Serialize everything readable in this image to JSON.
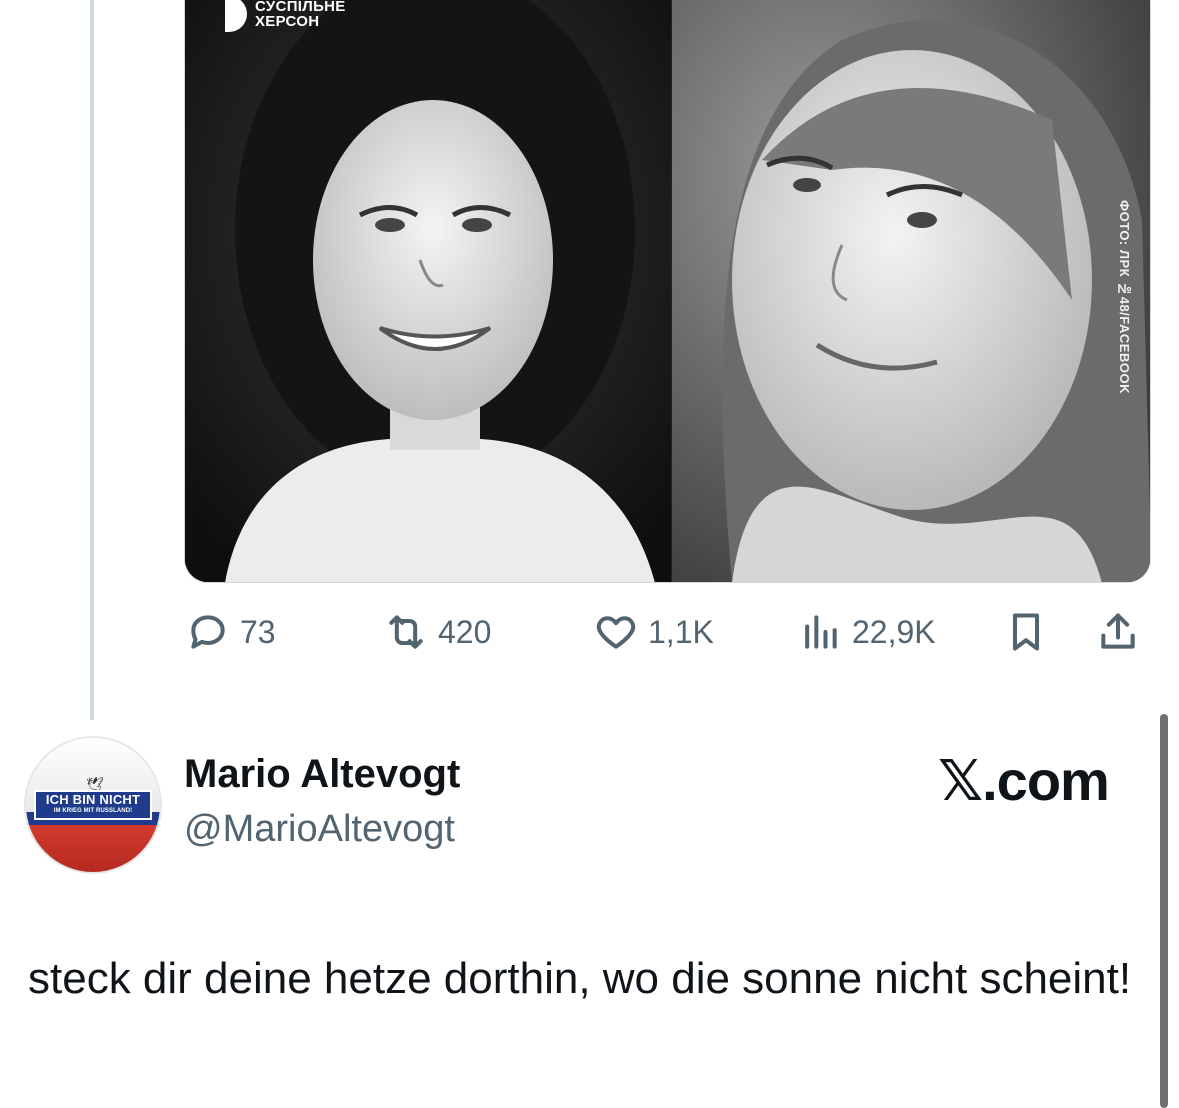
{
  "media": {
    "logo": {
      "line1": "СУСПІЛЬНЕ",
      "line2": "ХЕРСОН"
    },
    "photo_credit": "ФОТО: ЛРК №48/FACEBOOK"
  },
  "actions": {
    "replies": "73",
    "reposts": "420",
    "likes": "1,1K",
    "views": "22,9K"
  },
  "reply": {
    "name": "Mario Altevogt",
    "handle": "@MarioAltevogt",
    "brand": "𝕏.com",
    "avatar_badge_line1": "ICH BIN NICHT",
    "avatar_badge_line2": "IM KRIEG MIT RUSSLAND!",
    "text": "steck dir deine hetze dorthin, wo die sonne nicht scheint!"
  },
  "colors": {
    "text_primary": "#0f1419",
    "text_secondary": "#536471",
    "thread_line": "#cfd9de"
  }
}
